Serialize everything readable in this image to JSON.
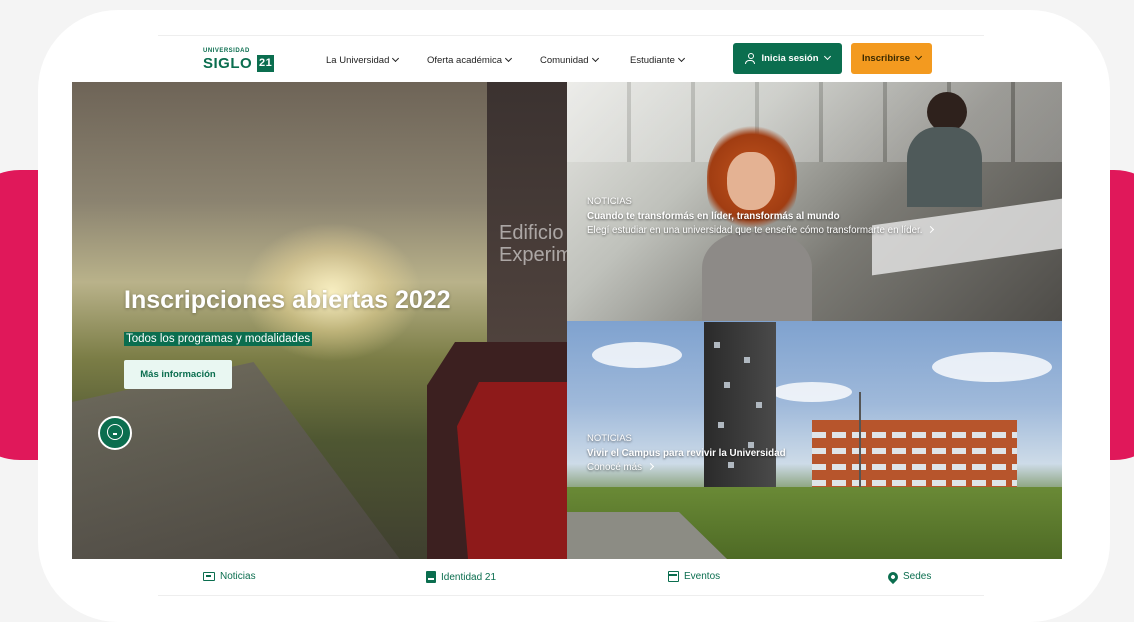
{
  "brand": {
    "logo_small": "UNIVERSIDAD",
    "logo_main": "SIGLO",
    "logo_badge": "21",
    "primary_color": "#0b6e4f",
    "accent_color": "#f39a1f",
    "decor_color": "#e0185a"
  },
  "nav": {
    "items": [
      {
        "label": "La Universidad"
      },
      {
        "label": "Oferta académica"
      },
      {
        "label": "Comunidad"
      },
      {
        "label": "Estudiante"
      }
    ],
    "login_label": "Inicia sesión",
    "join_label": "Inscribirse"
  },
  "hero": {
    "title": "Inscripciones abiertas 2022",
    "subtitle": "Todos los programas y modalidades",
    "cta_label": "Más información",
    "building_sign": "Edificio Experim"
  },
  "news": [
    {
      "label": "NOTICIAS",
      "title": "Cuando te transformás en líder, transformás al mundo",
      "description": "Elegí estudiar en una universidad que te enseñe cómo transformarte en líder."
    },
    {
      "label": "NOTICIAS",
      "title": "Vivir el Campus para revivir la Universidad",
      "link": "Conocé más"
    }
  ],
  "bottom_nav": [
    {
      "label": "Noticias",
      "icon": "newspaper-icon"
    },
    {
      "label": "Identidad 21",
      "icon": "id-card-icon"
    },
    {
      "label": "Eventos",
      "icon": "calendar-icon"
    },
    {
      "label": "Sedes",
      "icon": "location-pin-icon"
    }
  ]
}
